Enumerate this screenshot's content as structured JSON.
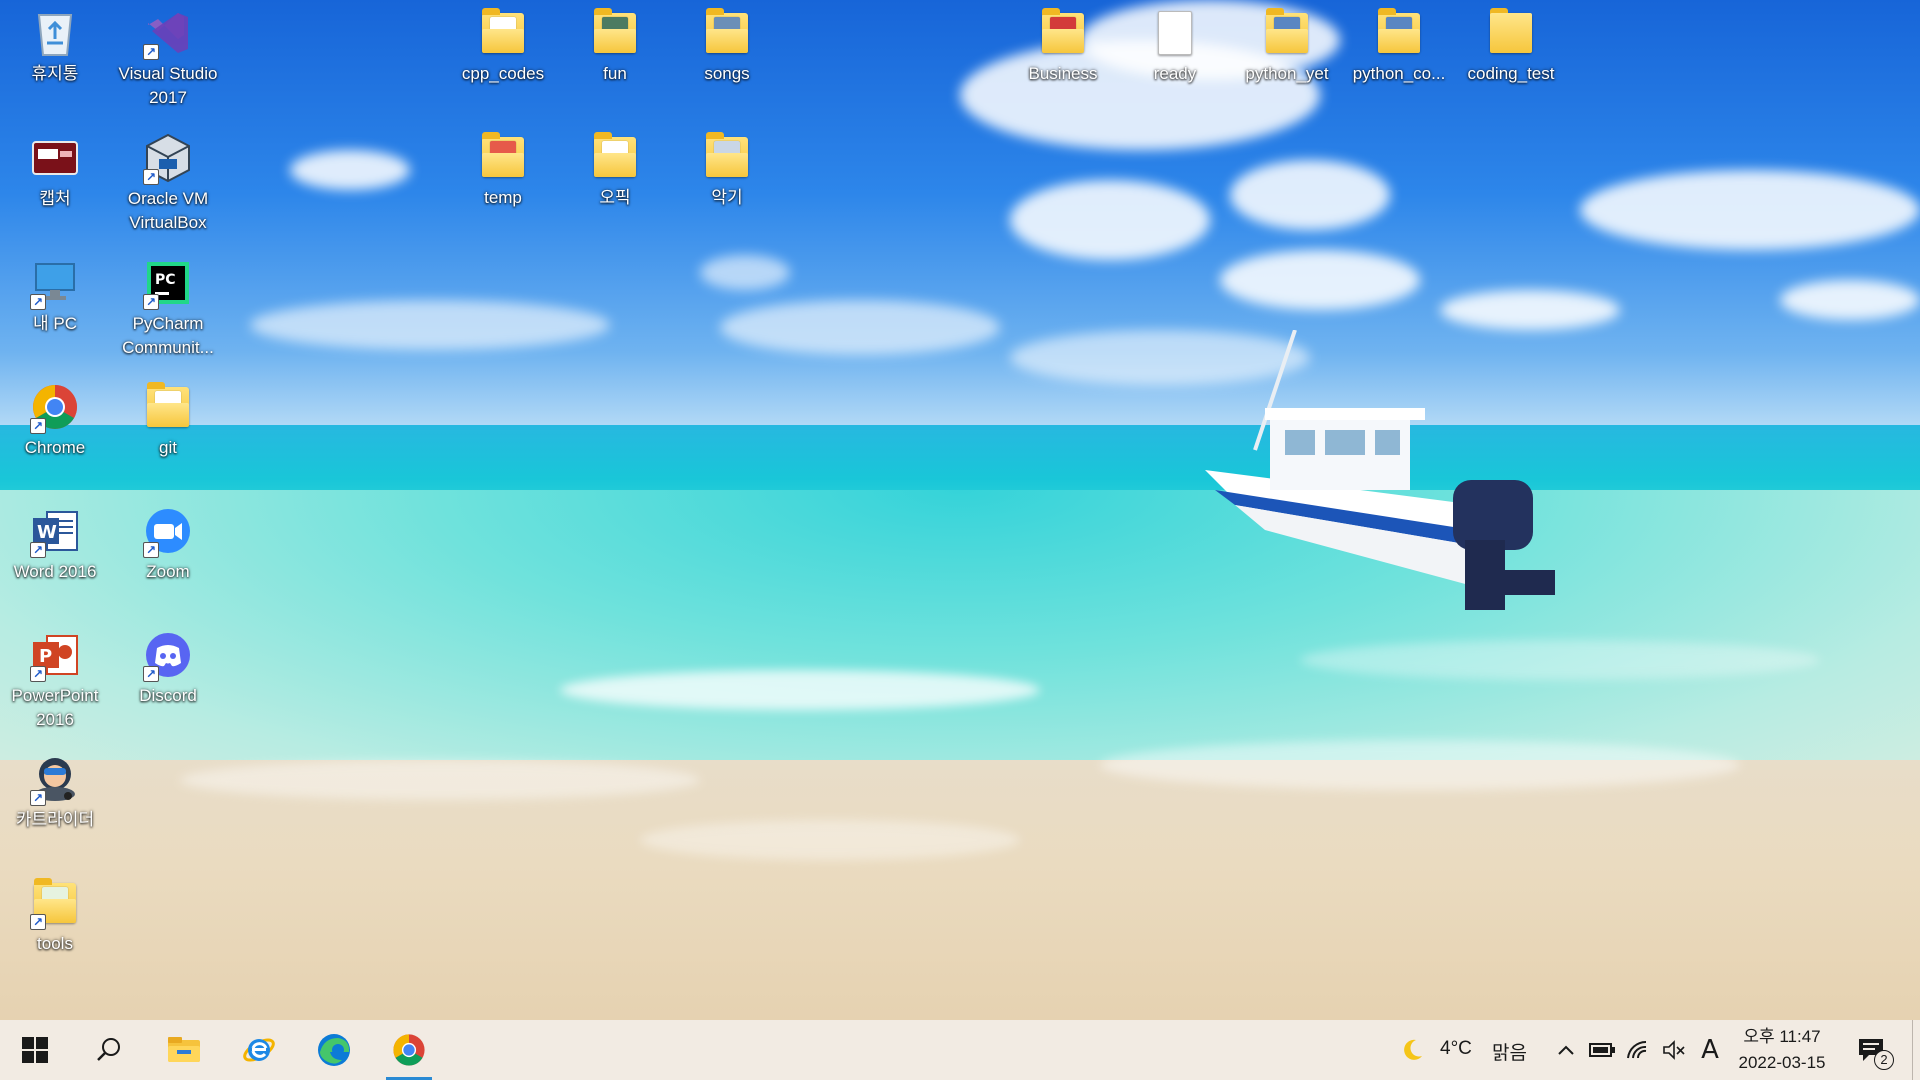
{
  "desktop": {
    "icons": [
      {
        "label": "휴지통",
        "icon": "recycle-bin-icon"
      },
      {
        "label": "Visual Studio 2017",
        "icon": "visual-studio-icon"
      },
      {
        "label": "캡처",
        "icon": "capture-icon"
      },
      {
        "label": "Oracle VM VirtualBox",
        "icon": "virtualbox-icon"
      },
      {
        "label": "내 PC",
        "icon": "this-pc-icon"
      },
      {
        "label": "PyCharm Communit...",
        "icon": "pycharm-icon"
      },
      {
        "label": "Chrome",
        "icon": "chrome-icon"
      },
      {
        "label": "git",
        "icon": "folder-icon"
      },
      {
        "label": "Word 2016",
        "icon": "word-icon"
      },
      {
        "label": "Zoom",
        "icon": "zoom-icon"
      },
      {
        "label": "PowerPoint 2016",
        "icon": "powerpoint-icon"
      },
      {
        "label": "Discord",
        "icon": "discord-icon"
      },
      {
        "label": "카트라이더",
        "icon": "kartrider-icon"
      },
      {
        "label": "tools",
        "icon": "folder-icon"
      },
      {
        "label": "cpp_codes",
        "icon": "folder-icon"
      },
      {
        "label": "fun",
        "icon": "folder-icon"
      },
      {
        "label": "songs",
        "icon": "folder-icon"
      },
      {
        "label": "temp",
        "icon": "folder-icon"
      },
      {
        "label": "오픽",
        "icon": "folder-icon"
      },
      {
        "label": "악기",
        "icon": "folder-icon"
      },
      {
        "label": "Business",
        "icon": "folder-icon"
      },
      {
        "label": "ready",
        "icon": "document-icon"
      },
      {
        "label": "python_yet",
        "icon": "folder-icon"
      },
      {
        "label": "python_co...",
        "icon": "folder-icon"
      },
      {
        "label": "coding_test",
        "icon": "folder-icon"
      }
    ]
  },
  "taskbar": {
    "pinned": [
      {
        "name": "start",
        "icon": "windows-icon"
      },
      {
        "name": "search",
        "icon": "search-icon"
      },
      {
        "name": "file-explorer",
        "icon": "file-explorer-icon"
      },
      {
        "name": "internet-explorer",
        "icon": "internet-explorer-icon"
      },
      {
        "name": "edge",
        "icon": "edge-icon"
      },
      {
        "name": "chrome",
        "icon": "chrome-icon",
        "active": true
      }
    ],
    "weather": {
      "temperature": "4°C",
      "condition": "맑음",
      "icon": "moon-icon"
    },
    "tray": {
      "language": "A"
    },
    "clock": {
      "time": "오후 11:47",
      "date": "2022-03-15"
    },
    "notifications": {
      "count": "2"
    }
  },
  "colors": {
    "taskbar_bg": "#f2ebe3",
    "active_indicator": "#2a8ad4",
    "folder_yellow": "#f5c232"
  }
}
